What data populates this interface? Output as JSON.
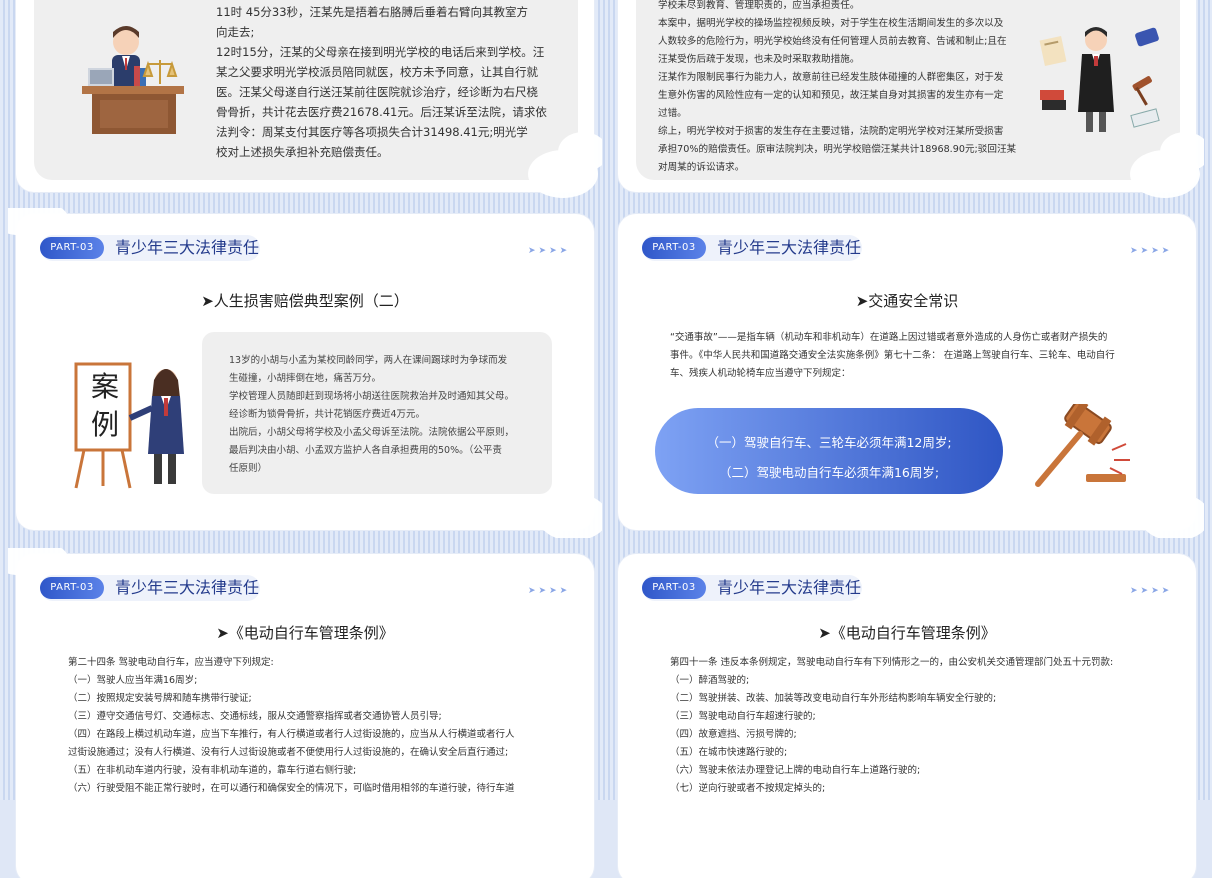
{
  "slides": {
    "s1": {
      "lines": [
        "11时 45分33秒，汪某先是捂着右胳膊后垂着右臂向其教室方",
        "向走去;",
        "12时15分，汪某的父母亲在接到明光学校的电话后来到学校。汪",
        "某之父要求明光学校派员陪同就医，校方未予同意，让其自行就",
        "医。汪某父母遂自行送汪某前往医院就诊治疗，经诊断为右尺桡",
        "骨骨折，共计花去医疗费21678.41元。后汪某诉至法院，请求依",
        "法判令：周某支付其医疗等各项损失合计31498.41元;明光学",
        "校对上述损失承担补充赔偿责任。"
      ]
    },
    "s2": {
      "lines": [
        "学校未尽到教育、管理职责的，应当承担责任。",
        "本案中，据明光学校的操场监控视频反映，对于学生在校生活期间发生的多次以及",
        "人数较多的危险行为，明光学校始终没有任何管理人员前去教育、告诫和制止;且在",
        "汪某受伤后疏于发现，也未及时采取救助措施。",
        "汪某作为限制民事行为能力人，故意前往已经发生肢体碰撞的人群密集区，对于发",
        "生意外伤害的风险性应有一定的认知和预见，故汪某自身对其损害的发生亦有一定",
        "过错。",
        "综上，明光学校对于损害的发生存在主要过错，法院酌定明光学校对汪某所受损害",
        "承担70%的赔偿责任。原审法院判决，明光学校赔偿汪某共计18968.90元;驳回汪某",
        "对周某的诉讼请求。"
      ]
    },
    "s3": {
      "part": "PART-03",
      "title": "青少年三大法律责任",
      "arrows": "➤➤➤➤",
      "heading": "➤人生损害赔偿典型案例（二）",
      "board_chars": [
        "案",
        "例"
      ],
      "lines": [
        "13岁的小胡与小孟为某校同龄同学，两人在课间踢球时为争球而发",
        "生碰撞，小胡摔倒在地，痛苦万分。",
        "学校管理人员随即赶到现场将小胡送往医院救治并及时通知其父母。",
        "经诊断为锁骨骨折，共计花销医疗费近4万元。",
        "出院后，小胡父母将学校及小孟父母诉至法院。法院依据公平原则，",
        "最后判决由小胡、小孟双方监护人各自承担费用的50%。（公平责",
        "任原则）"
      ]
    },
    "s4": {
      "part": "PART-03",
      "title": "青少年三大法律责任",
      "arrows": "➤➤➤➤",
      "heading": "➤交通安全常识",
      "lines": [
        "“交通事故”——是指车辆（机动车和非机动车）在道路上因过错或者意外造成的人身伤亡或者财产损失的",
        "事件。《中华人民共和国道路交通安全法实施条例》第七十二条：  在道路上驾驶自行车、三轮车、电动自行",
        "车、残疾人机动轮椅车应当遵守下列规定："
      ],
      "pill_lines": [
        "（一）驾驶自行车、三轮车必须年满12周岁;",
        "（二）驾驶电动自行车必须年满16周岁;"
      ]
    },
    "s5": {
      "part": "PART-03",
      "title": "青少年三大法律责任",
      "arrows": "➤➤➤➤",
      "heading": "➤《电动自行车管理条例》",
      "lines": [
        "第二十四条 驾驶电动自行车，应当遵守下列规定:",
        "（一）驾驶人应当年满16周岁;",
        "（二）按照规定安装号牌和随车携带行驶证;",
        "（三）遵守交通信号灯、交通标志、交通标线，服从交通警察指挥或者交通协管人员引导;",
        "（四）在路段上横过机动车道，应当下车推行，有人行横道或者行人过街设施的，应当从人行横道或者行人",
        "过街设施通过；没有人行横道、没有行人过街设施或者不便使用行人过街设施的，在确认安全后直行通过;",
        "（五）在非机动车道内行驶，没有非机动车道的，靠车行道右侧行驶;",
        "（六）行驶受阻不能正常行驶时，在可以通行和确保安全的情况下，可临时借用相邻的车道行驶，待行车道"
      ]
    },
    "s6": {
      "part": "PART-03",
      "title": "青少年三大法律责任",
      "arrows": "➤➤➤➤",
      "heading": "➤《电动自行车管理条例》",
      "lines": [
        "第四十一条 违反本条例规定，驾驶电动自行车有下列情形之一的，由公安机关交通管理部门处五十元罚款:",
        "（一）醉酒驾驶的;",
        "（二）驾驶拼装、改装、加装等改变电动自行车外形结构影响车辆安全行驶的;",
        "（三）驾驶电动自行车超速行驶的;",
        "（四）故意遮挡、污损号牌的;",
        "（五）在城市快速路行驶的;",
        "（六）驾驶未依法办理登记上牌的电动自行车上道路行驶的;",
        "（七）逆向行驶或者不按规定掉头的;"
      ]
    }
  }
}
